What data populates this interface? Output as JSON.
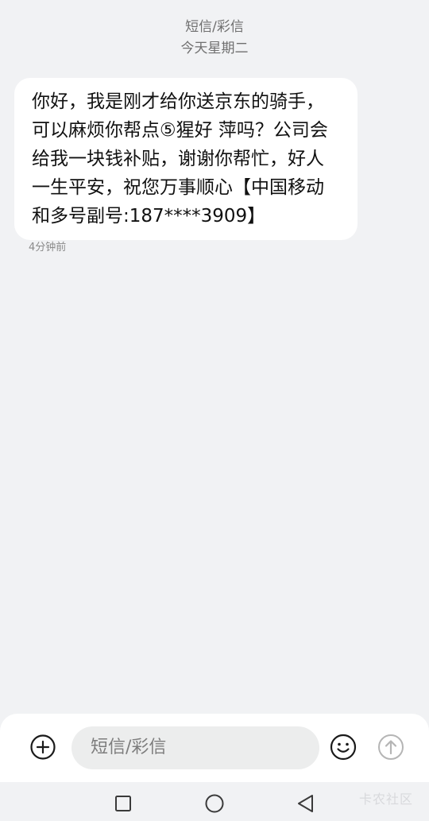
{
  "header": {
    "message_type": "短信/彩信",
    "date": "今天星期二"
  },
  "message": {
    "text": "你好，我是刚才给你送京东的骑手，可以麻烦你帮点⑤猩好 萍吗？公司会给我一块钱补贴，谢谢你帮忙，好人一生平安，祝您万事顺心【中国移动 和多号副号:187****3909】",
    "time": "4分钟前"
  },
  "composer": {
    "placeholder": "短信/彩信",
    "icons": {
      "add": "add-circle-icon",
      "emoji": "smiley-icon",
      "send": "send-arrow-up-icon"
    }
  },
  "navigation": {
    "icons": [
      "recent-apps-square-icon",
      "home-circle-icon",
      "back-triangle-icon"
    ]
  },
  "watermark": "卡农社区",
  "colors": {
    "background": "#f1f2f4",
    "bubble": "#ffffff",
    "secondary_text": "#6f6f6f"
  }
}
